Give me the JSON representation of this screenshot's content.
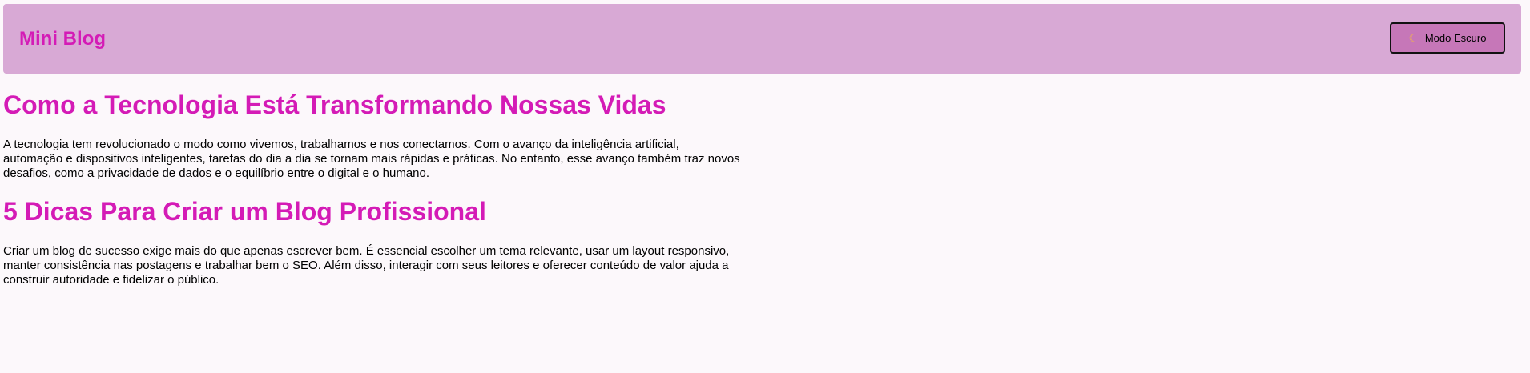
{
  "header": {
    "title": "Mini Blog",
    "theme_button": {
      "icon": "moon-icon",
      "label": "Modo Escuro"
    }
  },
  "posts": [
    {
      "title": "Como a Tecnologia Está Transformando Nossas Vidas",
      "body": "A tecnologia tem revolucionado o modo como vivemos, trabalhamos e nos conectamos. Com o avanço da inteligência artificial, automação e dispositivos inteligentes, tarefas do dia a dia se tornam mais rápidas e práticas. No entanto, esse avanço também traz novos desafios, como a privacidade de dados e o equilíbrio entre o digital e o humano."
    },
    {
      "title": "5 Dicas Para Criar um Blog Profissional",
      "body": "Criar um blog de sucesso exige mais do que apenas escrever bem. É essencial escolher um tema relevante, usar um layout responsivo, manter consistência nas postagens e trabalhar bem o SEO. Além disso, interagir com seus leitores e oferecer conteúdo de valor ajuda a construir autoridade e fidelizar o público."
    }
  ],
  "colors": {
    "background": "#fcf8fb",
    "header": "#d8a9d5",
    "accent": "#d41bb6",
    "button": "#c677b8"
  }
}
